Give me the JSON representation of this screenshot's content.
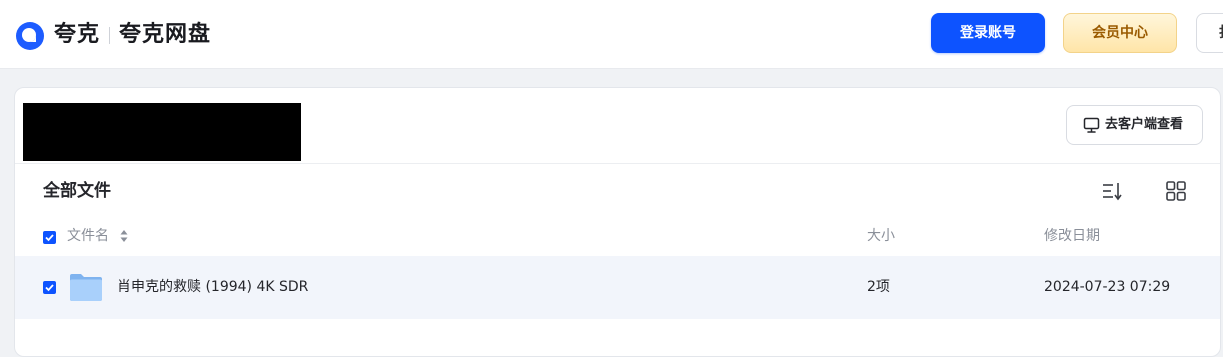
{
  "header": {
    "brand": "夸克",
    "product": "夸克网盘",
    "login_label": "登录账号",
    "vip_label": "会员中心",
    "partial_label": "打"
  },
  "panel": {
    "open_client_label": "去客户端查看",
    "section_title": "全部文件",
    "columns": {
      "name": "文件名",
      "size": "大小",
      "modified": "修改日期"
    },
    "files": [
      {
        "name": "肖申克的救赎 (1994) 4K SDR",
        "size": "2项",
        "modified": "2024-07-23 07:29",
        "type": "folder-icon",
        "checked": true
      }
    ]
  },
  "colors": {
    "accent": "#0d53ff",
    "vip_bg": "#ffe5a8",
    "vip_text": "#9a5a00",
    "row_highlight": "#f2f5fb"
  }
}
